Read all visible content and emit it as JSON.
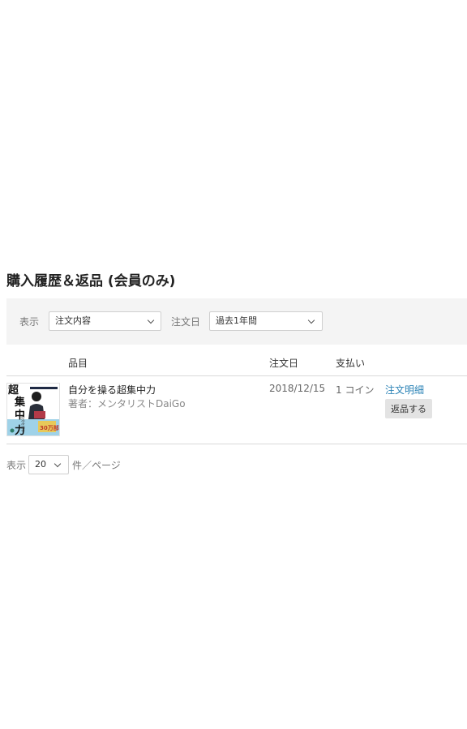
{
  "page": {
    "title": "購入履歴＆返品 (会員のみ)"
  },
  "filters": {
    "display_label": "表示",
    "display_value": "注文内容",
    "date_label": "注文日",
    "date_value": "過去1年間"
  },
  "table": {
    "headers": {
      "item": "品目",
      "order_date": "注文日",
      "payment": "支払い"
    },
    "rows": [
      {
        "title": "自分を操る超集中力",
        "author": "著者：メンタリストDaiGo",
        "order_date": "2018/12/15",
        "payment": "1 コイン",
        "detail_link": "注文明細",
        "return_button": "返品する",
        "cover": {
          "title_chars": [
            "超",
            "集",
            "中",
            "力"
          ],
          "subtitle": "自分を操る",
          "badge": "30万部"
        }
      }
    ]
  },
  "pager": {
    "display_label": "表示",
    "per_page_value": "20",
    "suffix": "件／ページ"
  },
  "colors": {
    "link": "#2b83b6",
    "filter_bg": "#f4f4f4",
    "button_bg": "#e3e3e3"
  }
}
